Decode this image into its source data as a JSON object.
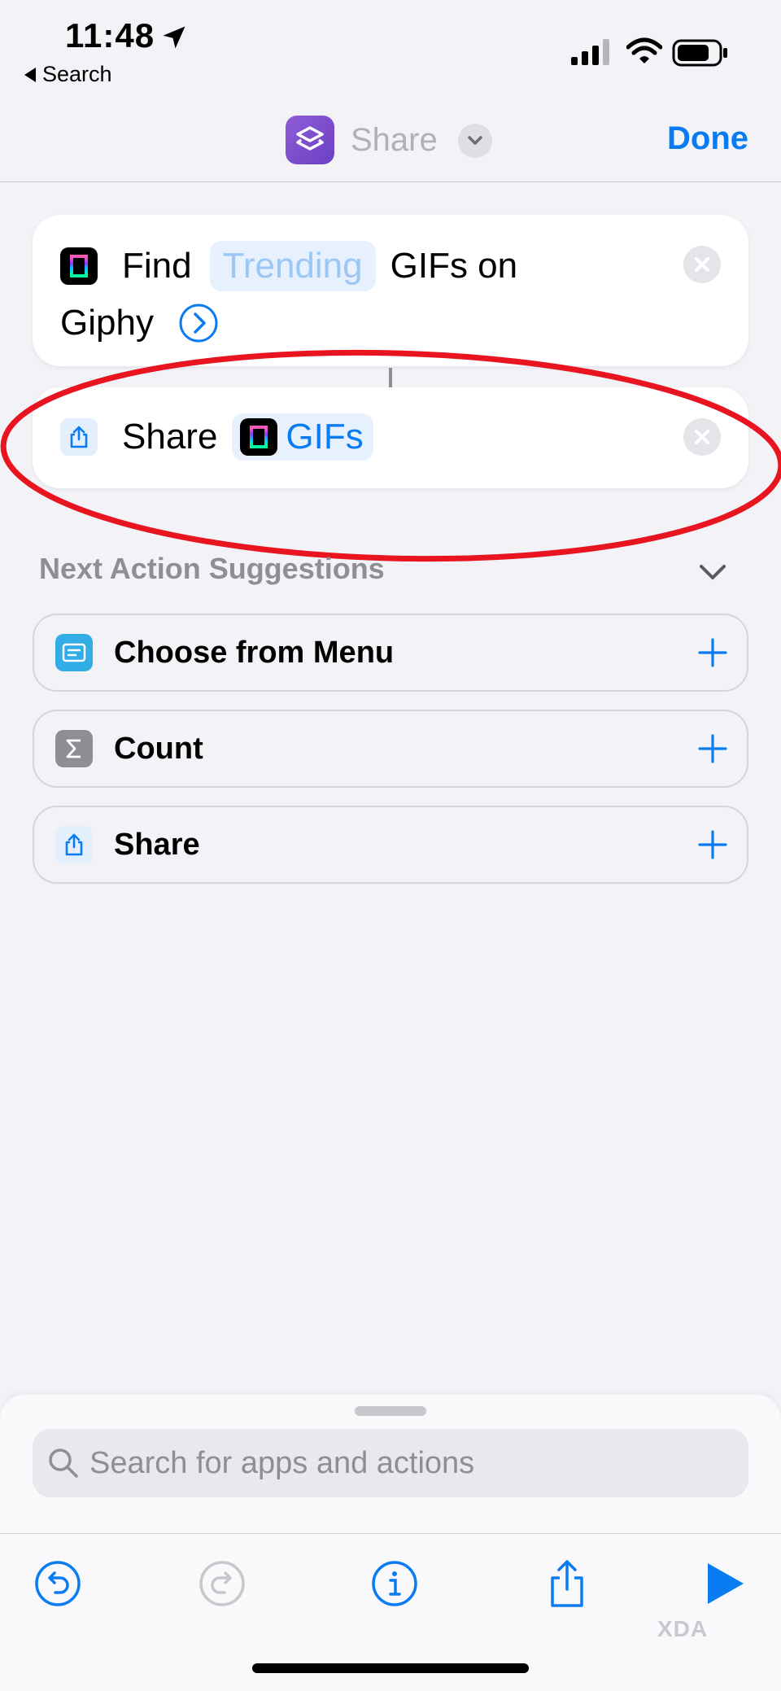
{
  "status_bar": {
    "time": "11:48",
    "back_label": "Search"
  },
  "nav": {
    "title": "Share",
    "done_label": "Done"
  },
  "actions": [
    {
      "verb": "Find",
      "token": "Trending",
      "rest": "GIFs on",
      "line2": "Giphy"
    },
    {
      "verb": "Share",
      "token": "GIFs"
    }
  ],
  "suggestions": {
    "header": "Next Action Suggestions",
    "items": [
      {
        "label": "Choose from Menu",
        "icon": "menu-icon",
        "color": "#32ade6"
      },
      {
        "label": "Count",
        "icon": "sigma-icon",
        "color": "#8e8e93"
      },
      {
        "label": "Share",
        "icon": "share-icon",
        "color": "#e3effd"
      }
    ]
  },
  "search": {
    "placeholder": "Search for apps and actions"
  },
  "watermark": "XDA",
  "colors": {
    "accent": "#0a7cf2",
    "annotation": "#e8141f",
    "background": "#f2f2f7"
  }
}
